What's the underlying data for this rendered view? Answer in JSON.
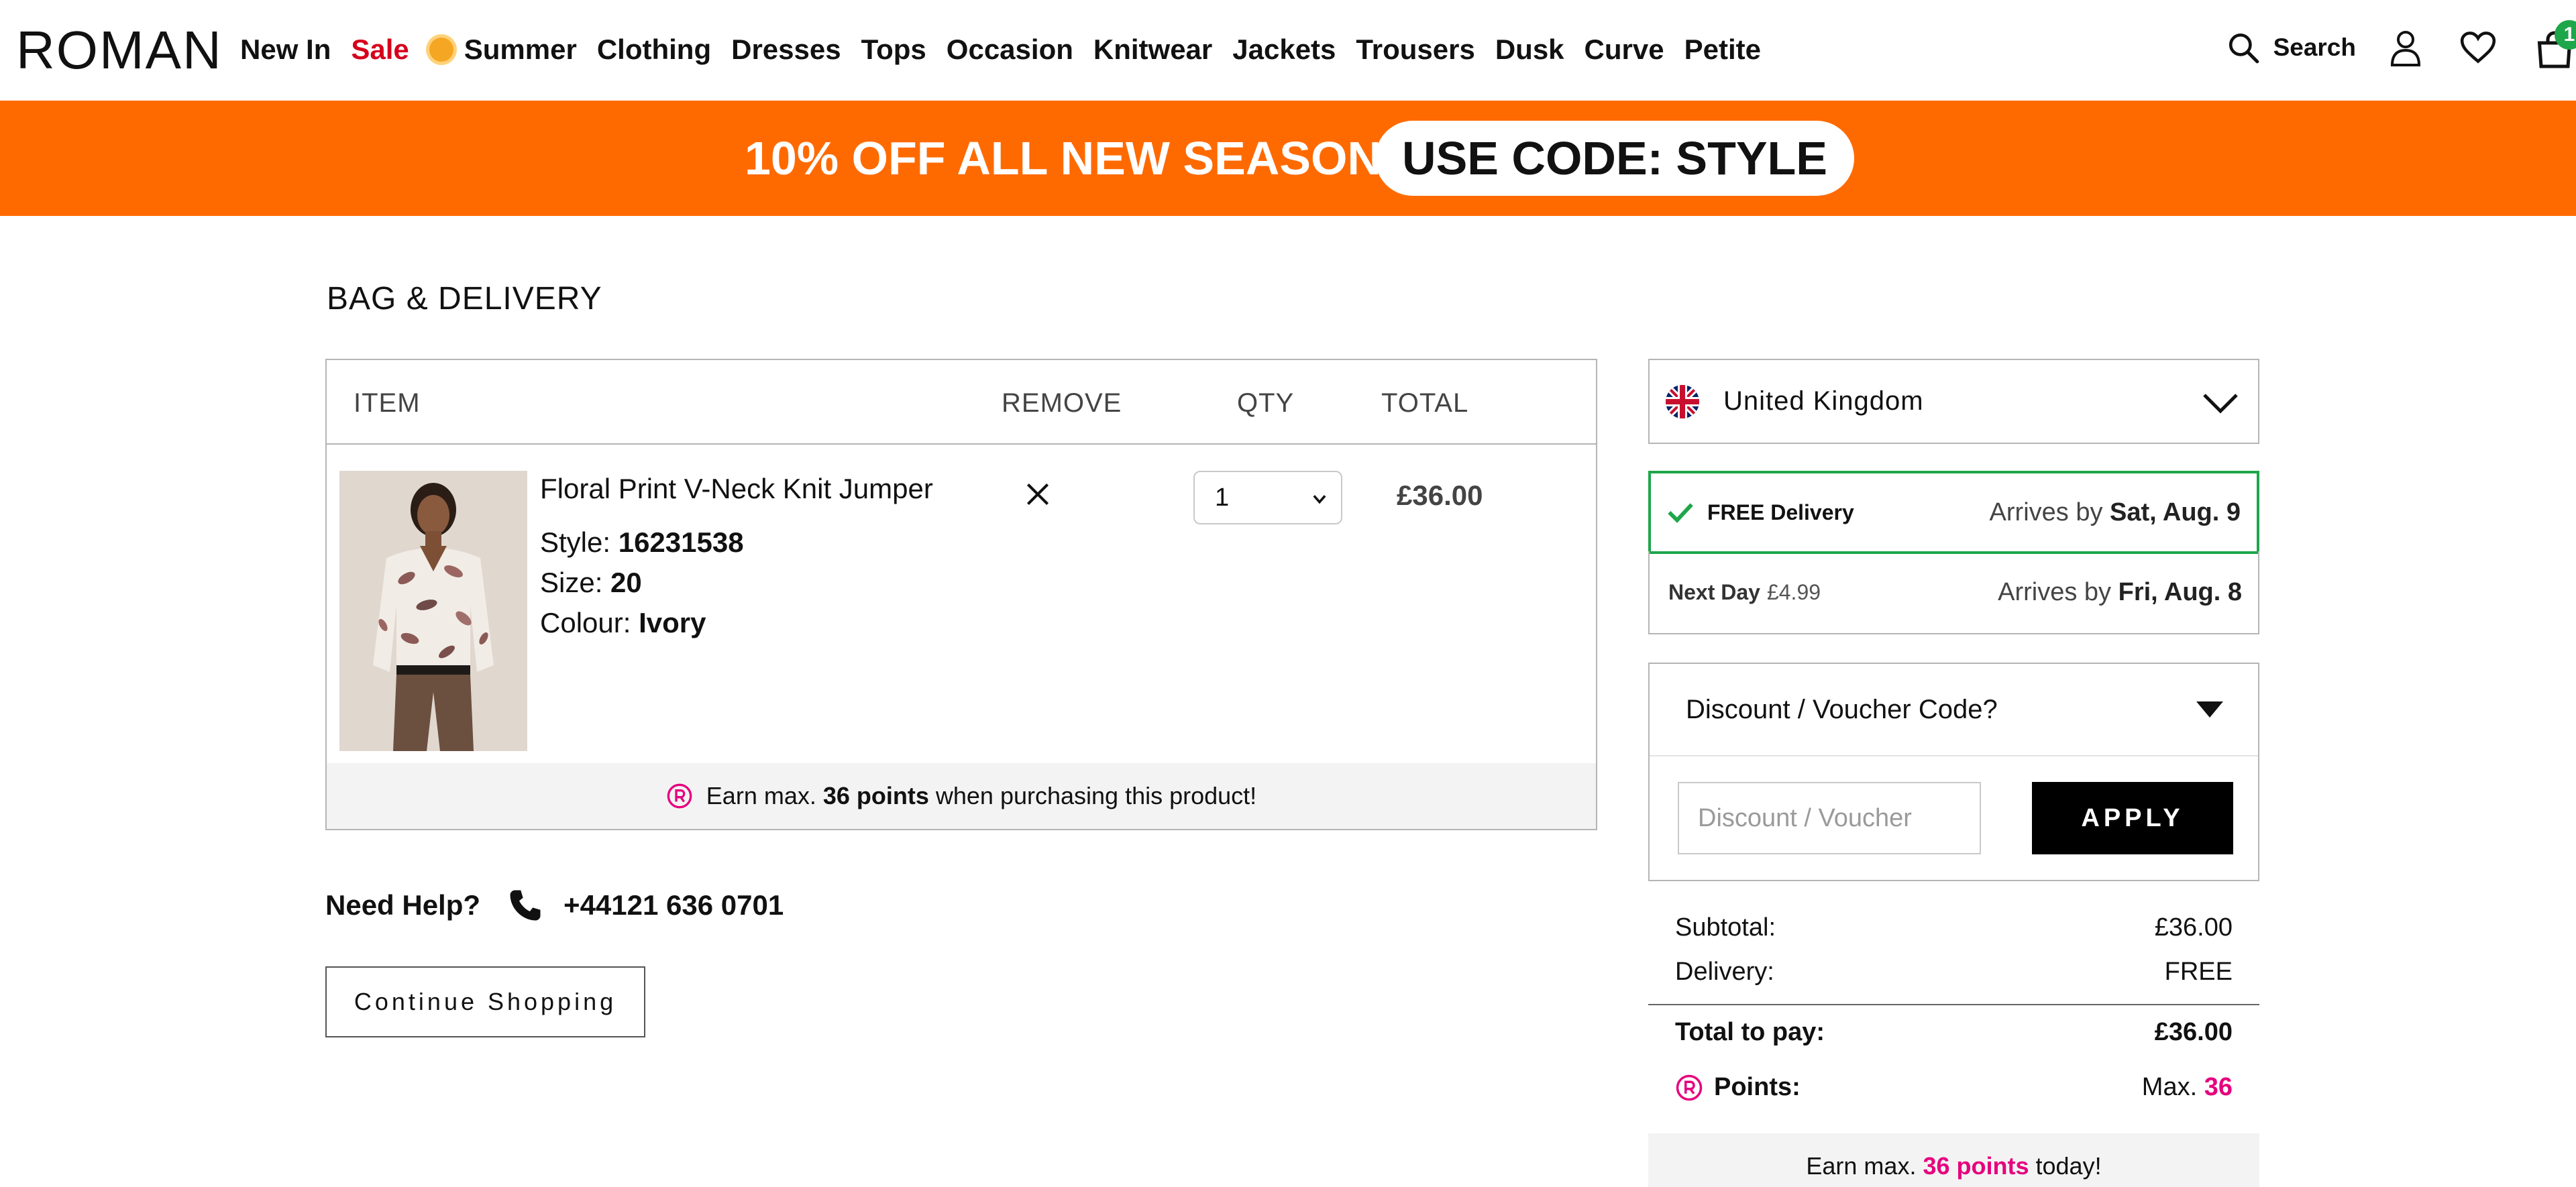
{
  "header": {
    "logo": "ROMAN",
    "nav": [
      {
        "label": "New In"
      },
      {
        "label": "Sale"
      },
      {
        "label": "Summer"
      },
      {
        "label": "Clothing"
      },
      {
        "label": "Dresses"
      },
      {
        "label": "Tops"
      },
      {
        "label": "Occasion"
      },
      {
        "label": "Knitwear"
      },
      {
        "label": "Jackets"
      },
      {
        "label": "Trousers"
      },
      {
        "label": "Dusk"
      },
      {
        "label": "Curve"
      },
      {
        "label": "Petite"
      }
    ],
    "search_label": "Search",
    "bag_count": "1",
    "icons": [
      "search-icon",
      "account-icon",
      "heart-icon",
      "bag-icon"
    ]
  },
  "promo": {
    "text": "10% OFF ALL NEW SEASON",
    "code": "USE CODE: STYLE",
    "color": "#ff6a00"
  },
  "page": {
    "title": "BAG & DELIVERY"
  },
  "cart": {
    "headers": {
      "item": "ITEM",
      "remove": "REMOVE",
      "qty": "QTY",
      "total": "TOTAL"
    },
    "items": [
      {
        "name": "Floral Print V-Neck Knit Jumper",
        "style_label": "Style:",
        "style": "16231538",
        "size_label": "Size:",
        "size": "20",
        "colour_label": "Colour:",
        "colour": "Ivory",
        "qty": "1",
        "total": "£36.00",
        "earn_pre": "Earn max.",
        "earn_points": "36 points",
        "earn_post": "when purchasing this product!"
      }
    ]
  },
  "help": {
    "label": "Need Help?",
    "phone": "+44121 636 0701"
  },
  "continue_label": "Continue Shopping",
  "delivery": {
    "country": "United Kingdom",
    "options": [
      {
        "name": "FREE Delivery",
        "price": "",
        "arrives_pre": "Arrives by",
        "arrives": "Sat, Aug. 9",
        "selected": true
      },
      {
        "name": "Next Day",
        "price": "£4.99",
        "arrives_pre": "Arrives by",
        "arrives": "Fri, Aug. 8",
        "selected": false
      }
    ]
  },
  "voucher": {
    "title": "Discount / Voucher Code?",
    "placeholder": "Discount / Voucher",
    "apply_label": "APPLY"
  },
  "summary": {
    "subtotal_label": "Subtotal:",
    "subtotal": "£36.00",
    "delivery_label": "Delivery:",
    "delivery": "FREE",
    "total_label": "Total to pay:",
    "total": "£36.00",
    "points_label": "Points:",
    "points_pre": "Max.",
    "points": "36",
    "earn_pre": "Earn max.",
    "earn_points": "36 points",
    "earn_post": "today!"
  },
  "colors": {
    "accent_green": "#1ea64a",
    "points_pink": "#e6007e",
    "sale_red": "#d6001c"
  }
}
